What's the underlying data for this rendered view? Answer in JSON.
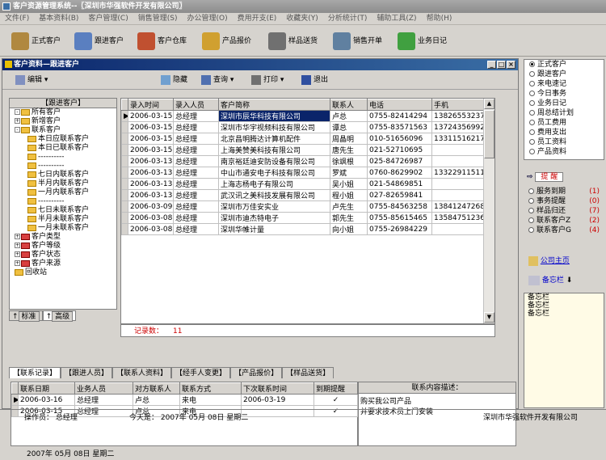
{
  "app": {
    "title": "客户资源管理系统--〖深圳市华强软件开发有限公司〗"
  },
  "menu": [
    "文件(F)",
    "基本资料(B)",
    "客户管理(C)",
    "销售管理(S)",
    "办公管理(O)",
    "费用开支(E)",
    "收藏夹(Y)",
    "分析统计(T)",
    "辅助工具(Z)",
    "帮助(H)"
  ],
  "toolbar": [
    {
      "label": "正式客户",
      "icon": "person-icon",
      "color": "#b08840"
    },
    {
      "label": "跟进客户",
      "icon": "handshake-icon",
      "color": "#5a7fc0"
    },
    {
      "label": "客户仓库",
      "icon": "warehouse-icon",
      "color": "#c05030"
    },
    {
      "label": "产品报价",
      "icon": "price-tag-icon",
      "color": "#d0a030"
    },
    {
      "label": "样品送货",
      "icon": "delivery-icon",
      "color": "#707070"
    },
    {
      "label": "销售开单",
      "icon": "pen-icon",
      "color": "#6080a0"
    },
    {
      "label": "业务日记",
      "icon": "globe-icon",
      "color": "#40a040"
    }
  ],
  "child": {
    "title": "客户资料—跟进客户",
    "edit": "编辑",
    "hide": "隐藏",
    "query": "查询",
    "print": "打印",
    "exit": "退出"
  },
  "tree": {
    "header": "【跟进客户】",
    "nodes": [
      {
        "label": "所有客户",
        "level": 1,
        "red": false,
        "ex": "-"
      },
      {
        "label": "新增客户",
        "level": 1,
        "red": false,
        "ex": "+"
      },
      {
        "label": "联系客户",
        "level": 1,
        "red": false,
        "ex": "-"
      },
      {
        "label": "本日应联系客户",
        "level": 2,
        "red": false,
        "ex": ""
      },
      {
        "label": "本日已联系客户",
        "level": 2,
        "red": false,
        "ex": ""
      },
      {
        "label": "----------",
        "level": 2,
        "red": false,
        "ex": ""
      },
      {
        "label": "----------",
        "level": 2,
        "red": false,
        "ex": ""
      },
      {
        "label": "七日内联系客户",
        "level": 2,
        "red": false,
        "ex": ""
      },
      {
        "label": "半月内联系客户",
        "level": 2,
        "red": false,
        "ex": ""
      },
      {
        "label": "一月内联系客户",
        "level": 2,
        "red": false,
        "ex": ""
      },
      {
        "label": "----------",
        "level": 2,
        "red": false,
        "ex": ""
      },
      {
        "label": "七日未联系客户",
        "level": 2,
        "red": false,
        "ex": ""
      },
      {
        "label": "半月未联系客户",
        "level": 2,
        "red": false,
        "ex": ""
      },
      {
        "label": "一月未联系客户",
        "level": 2,
        "red": false,
        "ex": ""
      },
      {
        "label": "客户类型",
        "level": 1,
        "red": true,
        "ex": "+"
      },
      {
        "label": "客户等级",
        "level": 1,
        "red": true,
        "ex": "+"
      },
      {
        "label": "客户状态",
        "level": 1,
        "red": true,
        "ex": "+"
      },
      {
        "label": "客户来源",
        "level": 1,
        "red": true,
        "ex": "+"
      },
      {
        "label": "回收站",
        "level": 1,
        "red": false,
        "ex": ""
      }
    ],
    "tab_std": "标准",
    "tab_adv": "高级"
  },
  "grid": {
    "columns": [
      "录入时间",
      "录入人员",
      "客户简称",
      "联系人",
      "电话",
      "手机"
    ],
    "rows": [
      [
        "2006-03-15",
        "总经理",
        "深圳市辰华科技有限公司",
        "卢总",
        "0755-82414294",
        "13826553237"
      ],
      [
        "2006-03-15",
        "总经理",
        "深圳市华宇视频科技有限公司",
        "谭总",
        "0755-83571563",
        "13724356992"
      ],
      [
        "2006-03-15",
        "总经理",
        "北京昌明腾达计算机配件",
        "周晶明",
        "010-51656096",
        "13311516217"
      ],
      [
        "2006-03-15",
        "总经理",
        "上海美赞美科技有限公司",
        "唐先生",
        "021-52710695",
        ""
      ],
      [
        "2006-03-13",
        "总经理",
        "南京裕廷迪安防设备有限公司",
        "徐飒根",
        "025-84726987",
        ""
      ],
      [
        "2006-03-13",
        "总经理",
        "中山市通安电子科技有限公司",
        "罗斌",
        "0760-8629902",
        "13322911511"
      ],
      [
        "2006-03-13",
        "总经理",
        "上海志杨电子有限公司",
        "吴小姐",
        "021-54869851",
        ""
      ],
      [
        "2006-03-13",
        "总经理",
        "武汉讯之美科技发展有限公司",
        "程小姐",
        "027-82659841",
        ""
      ],
      [
        "2006-03-09",
        "总经理",
        "深圳市万佳安实业",
        "卢先生",
        "0755-84563258",
        "13841247268"
      ],
      [
        "2006-03-08",
        "总经理",
        "深圳市迪杰特电子",
        "郭先生",
        "0755-85615465",
        "13584751236"
      ],
      [
        "2006-03-08",
        "总经理",
        "深圳华帷计量",
        "向小姐",
        "0755-26984229",
        ""
      ]
    ],
    "record_label": "记录数：",
    "record_count": "11"
  },
  "subtabs": [
    "【联系记录】",
    "【跟进人员】",
    "【联系人资料】",
    "【经手人变更】",
    "【产品报价】",
    "【样品送货】"
  ],
  "contact": {
    "columns": [
      "联系日期",
      "业务人员",
      "对方联系人",
      "联系方式",
      "下次联系时间",
      "到期提醒"
    ],
    "rows": [
      [
        "2006-03-16",
        "总经理",
        "卢总",
        "来电",
        "2006-03-19",
        "✓"
      ],
      [
        "2006-03-15",
        "总经理",
        "卢总",
        "来电",
        "",
        "✓"
      ]
    ],
    "memo_header": "联系内容描述：",
    "memo_text_1": "购买我公司产品",
    "memo_text_2": "并要求技术员上门安装"
  },
  "datebar": "2007年 05月 08日   星期二",
  "status": {
    "operator": "操作员：  总经理",
    "today": "今天是：  2007年  05月  08日   星期二",
    "company": "深圳市华强软件开发有限公司"
  },
  "right": {
    "options": [
      "正式客户",
      "跟进客户",
      "来电速记",
      "今日事务",
      "业务日记",
      "周总结计划",
      "员工费用",
      "费用支出",
      "员工资料",
      "产品资料"
    ],
    "selected": 0,
    "remind_title": "提 醒",
    "reminders": [
      {
        "label": "服务到期",
        "count": "(1)"
      },
      {
        "label": "事务提醒",
        "count": "(0)"
      },
      {
        "label": "样品归还",
        "count": "(7)"
      },
      {
        "label": "联系客户Z",
        "count": "(2)"
      },
      {
        "label": "联系客户G",
        "count": "(4)"
      }
    ],
    "home": "公司主页",
    "memo": "备忘栏",
    "notes": [
      "备忘栏",
      "备忘栏",
      "备忘栏"
    ]
  }
}
